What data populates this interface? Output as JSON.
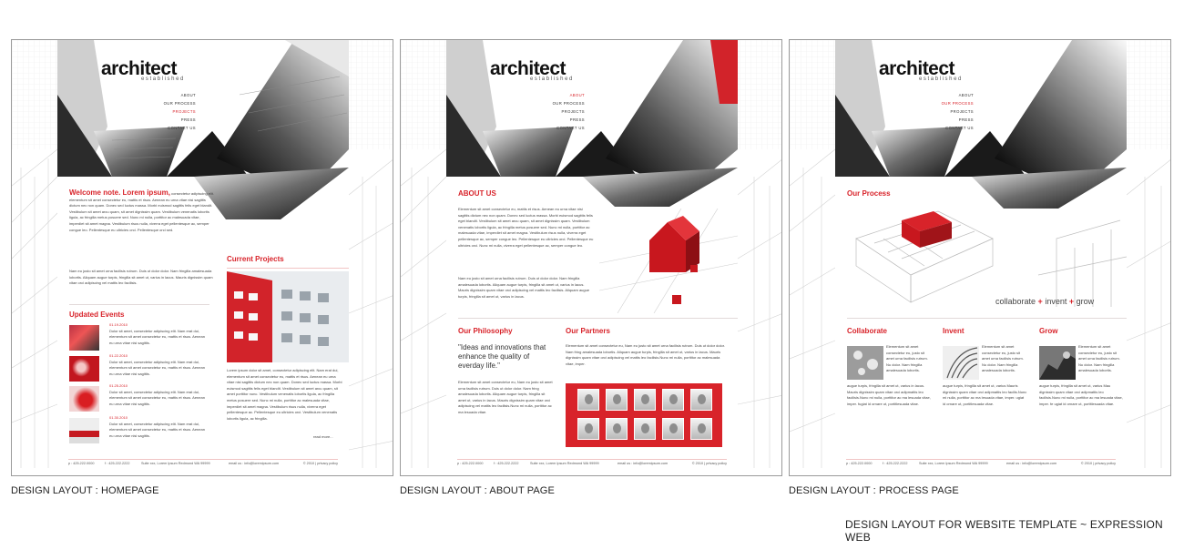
{
  "layouts": [
    {
      "caption": "DESIGN LAYOUT : HOMEPAGE",
      "logo": "architect",
      "logo_sub": "established",
      "nav": [
        "ABOUT",
        "OUR PROCESS",
        "PROJECTS",
        "PRESS",
        "CONTACT US"
      ],
      "nav_active": "PROJECTS",
      "welcome_red": "Welcome note. Lorem ipsum,",
      "welcome_text": "consectetur adipiscing elit. elementum sit amet consectetur eu, mattis et risus. Aenean eu urna vitae nisi sagittis dictum nec non quam. Donec sed luctus massa. Morbi euismod sagittis felis eget blandit. Vestibulum sit amet arcu quam, sit amet dignissim quam. Vestibulum venenatis lobortis ligula, ac fringilla metus posuere sed. Nunc mi nulla, porttitor ac malesuada vitae, imperdiet sit amet magna. Vestibulum risus nulla, viverra eget pellentesque ac, semper congue leo. Pellentesque eu ultricies orci. Pellentesque orci sed.",
      "welcome_text2": "Nam eu justo sit amet urna facilisis rutrum. Duis ut dolor dolor. Nam fringilla amalesuada lobortis. Aliquam augue turpis, fringilla sit amet ut, varius in lacus. Mauris dignissim quam vitae orci adipiscing vel mattis leo facilisis.",
      "updated_events_title": "Updated Events",
      "events": [
        {
          "date": "01.19.2010",
          "text": "Dolor sit amet, consectetur adipiscing elit. Nam erat dui, elementum sit amet consectetur eu, mattis et risus. Aenean eu urna vitae nisi sagittis."
        },
        {
          "date": "01.22.2010",
          "text": "Dolor sit amet, consectetur adipiscing elit. Nam erat dui, elementum sit amet consectetur eu, mattis et risus. Aenean eu urna vitae nisi sagittis."
        },
        {
          "date": "01.25.2010",
          "text": "Dolor sit amet, consectetur adipiscing elit. Nam erat dui, elementum sit amet consectetur eu, mattis et risus. Aenean eu urna vitae nisi sagittis."
        },
        {
          "date": "01.30.2010",
          "text": "Dolor sit amet, consectetur adipiscing elit. Nam erat dui, elementum sit amet consectetur eu, mattis et risus. Aenean eu urna vitae nisi sagittis."
        }
      ],
      "current_projects_title": "Current Projects",
      "projects_text": "Lorem ipsum dolor sit amet, consectetur adipiscing elit. Nam erat dui, elementum sit amet consectetur eu, mattis et risus. Aenean eu urna vitae nisi sagittis dictum nec non quam. Donec sed luctus massa. Morbi euismod sagittis felis eget blandit. Vestibulum sit amet arcu quam, sit amet porttitor nunc. Vestibulum venenatis lobortis ligula, ac fringilla metus posuere sed. Nunc mi nulla, porttitor ac malesuada vitae, imperdiet sit amet magna. Vestibulum risus nulla, viverra eget pellentesque ac. Pellentesque eu ultricies orci. Vestibulum venenatis lobortis ligula, ac fringilla.",
      "read_more": "read more...",
      "footer": {
        "phone": "p : 425.222.0000",
        "fax": "f : 425.222.2222",
        "address": "Suite xxx, Lorem Ipsum Redmond WA 99999",
        "email": "email us :   info@loremipsum.com",
        "copy": "© 2010 | privacy policy"
      }
    },
    {
      "caption": "DESIGN LAYOUT : ABOUT PAGE",
      "logo": "architect",
      "logo_sub": "established",
      "nav": [
        "ABOUT",
        "OUR PROCESS",
        "PROJECTS",
        "PRESS",
        "CONTACT US"
      ],
      "nav_active": "ABOUT",
      "about_title": "ABOUT US",
      "about_text": "Elementum sit amet consectetur eu, mattis et risus. Aenean eu urna vitae nisi sagittis dictum nec non quam. Donec sed luctus massa. Morbi euismod sagittis felis eget blandit. Vestibulum sit amet arcu quam, sit amet dignissim quam. Vestibulum venenatis lobortis ligula, ac fringilla metus posuere sed. Nunc mi nulla, porttitor ac malesuada vitae, imperdiet sit amet magna. Vestibulum risus nulla, viverra eget pellentesque ac, semper congue leo. Pellentesque eu ultricies orci. Pellentesque eu ultricies orci. Nunc mi nulla, viverra eget pellentesque ac, semper congue leo.",
      "about_text2": "Nam eu justo sit amet urna facilisis rutrum. Duis ut dolor dolor. Nam fringilla amalesuada lobortis. Aliquam augue turpis, fringilla sit amet ut, varius in lacus. Mauris dignissim quam vitae orci adipiscing vel mattis leo facilisis. Aliquam augue turpis, fringilla sit amet ut, varius in lacus.",
      "philosophy_title": "Our Philosophy",
      "quote": "\"Ideas and innovations that enhance the quality of everday life.\"",
      "philosophy_text": "Elementum sit amet consectetur eu, Nam eu justo sit amet urna facilisis rutrum. Duis ut dolor dolor. Nam fring amalesuada lobortis. Aliquam augue turpis, fringilla sit amet ut, varius in lacus. Mauris dignissim quam vitae orci adipiscing vel mattis leo facilisis.Nunc mi nulla, porttitor ac ma lesuada vitae.",
      "partners_title": "Our Partners",
      "partners_text": "Elementum sit amet consectetur eu, Nam eu justo sit amet urna facilisis rutrum. Duis ut dolor dolor. Nam fring amalesuada lobortis. Aliquam augue turpis, fringilla sit amet ut, varius in lacus. Mauris dignissim quam vitae orci adipiscing vel mattis leo facilisis.Nunc mi nulla, porttitor ac malesuada vitae, imper.",
      "footer": {
        "phone": "p : 425.222.0000",
        "fax": "f : 425.222.2222",
        "address": "Suite xxx, Lorem Ipsum Redmond WA 99999",
        "email": "email us :   info@loremipsum.com",
        "copy": "© 2010 | privacy policy"
      }
    },
    {
      "caption": "DESIGN LAYOUT : PROCESS PAGE",
      "logo": "architect",
      "logo_sub": "established",
      "nav": [
        "ABOUT",
        "OUR PROCESS",
        "PROJECTS",
        "PRESS",
        "CONTACT US"
      ],
      "nav_active": "OUR PROCESS",
      "process_title": "Our Process",
      "tagline_1": "collaborate",
      "tagline_plus": "+",
      "tagline_2": "invent",
      "tagline_3": "grow",
      "columns": [
        {
          "title": "Collaborate",
          "short": "Elementum sit amet consectetur eu, justo sit amet urna facilisis rutrum. Nu dolor. Nam fringilla amalesuada lobortis.",
          "long": "augue turpis, fringilla sit amet ut, varius in lacus. Mauris dignissim quam vitae orci adipmattis leo facilisis.Nunc mi nulla, porttitor ac ma lesuada vitae, imper. fugiat id ornare ut, portitlesuada vitae."
        },
        {
          "title": "Invent",
          "short": "Elementum sit amet consectetur eu, justo sit amet urna facilisis rutrum. Nu dolor. Nam fringilla amalesuada lobortis.",
          "long": "augue turpis, fringilla sit amet ut, varius Mauris dignissim quam vitae orci adipmattis leo facilis.Nunc mi nulla, porttitor ac ma lesuada vitae, imper. ugiat id ornare ut, portitlesuada vitae."
        },
        {
          "title": "Grow",
          "short": "Elementum sit amet consectetur eu, justo sit amet urna facilisis rutrum. Nu dolor. Nam fringilla amalesuada lobortis.",
          "long": "augue turpis, fringilla sit amet ut, varius Mau dignissim quam vitae orci adipmattis leo facilisis.Nunc mi nulla, porttitor ac ma lesuada vitae, imper. fe ugiat id ornare ut, portitlesuada vitae."
        }
      ],
      "footer": {
        "phone": "p : 425.222.0000",
        "fax": "f : 425.222.2222",
        "address": "Suite xxx, Lorem Ipsum Redmond WA 99999",
        "email": "email us :   info@loremipsum.com",
        "copy": "© 2010 | privacy policy"
      }
    }
  ],
  "main_caption": "DESIGN LAYOUT FOR WEBSITE TEMPLATE ~ EXPRESSION WEB",
  "colors": {
    "accent": "#d8232a",
    "text": "#333333",
    "border": "#9a9a9a"
  }
}
